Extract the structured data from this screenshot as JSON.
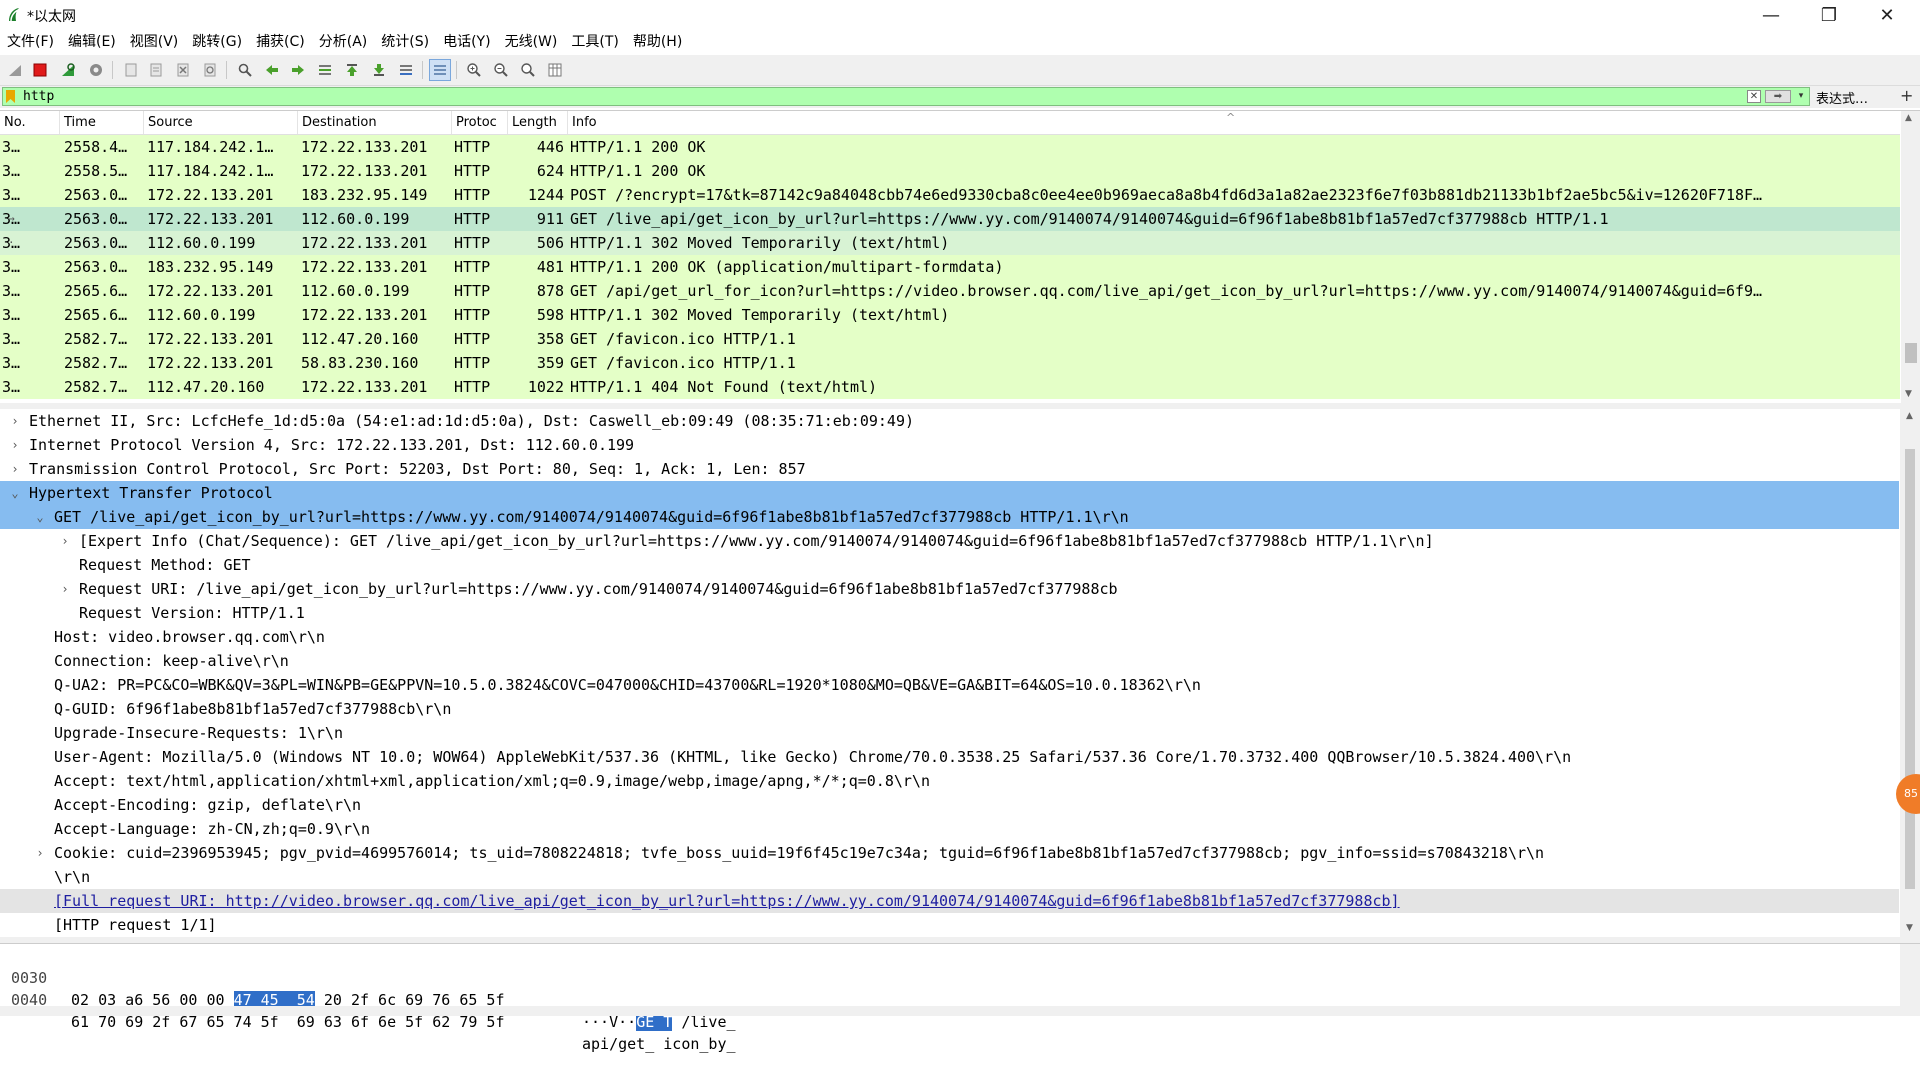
{
  "window": {
    "title": "*以太网",
    "min_glyph": "—",
    "max_glyph": "❐",
    "close_glyph": "✕"
  },
  "menu": [
    "文件(F)",
    "编辑(E)",
    "视图(V)",
    "跳转(G)",
    "捕获(C)",
    "分析(A)",
    "统计(S)",
    "电话(Y)",
    "无线(W)",
    "工具(T)",
    "帮助(H)"
  ],
  "toolbar_icons": [
    "shark-fin-icon",
    "stop-capture-icon",
    "restart-capture-icon",
    "capture-options-icon",
    "open-file-icon",
    "save-file-icon",
    "close-file-icon",
    "reload-icon",
    "find-packet-icon",
    "go-back-icon",
    "go-forward-icon",
    "go-to-packet-icon",
    "go-first-icon",
    "go-last-icon",
    "auto-scroll-icon",
    "colorize-icon",
    "zoom-in-icon",
    "zoom-out-icon",
    "zoom-reset-icon",
    "resize-columns-icon"
  ],
  "filter": {
    "value": "http",
    "expression_button": "表达式…",
    "plus": "+",
    "clear_glyph": "✕",
    "apply_glyph": "➡",
    "dropdown_glyph": "▾",
    "bg_color": "#afffaf"
  },
  "packet_list": {
    "columns": [
      "No.",
      "Time",
      "Source",
      "Destination",
      "Protoc",
      "Length",
      "Info"
    ],
    "sort_caret": "^",
    "rows": [
      {
        "no": "3…",
        "time": "2558.4…",
        "source": "117.184.242.1…",
        "destination": "172.22.133.201",
        "protocol": "HTTP",
        "length": "446",
        "info": "HTTP/1.1 200 OK"
      },
      {
        "no": "3…",
        "time": "2558.5…",
        "source": "117.184.242.1…",
        "destination": "172.22.133.201",
        "protocol": "HTTP",
        "length": "624",
        "info": "HTTP/1.1 200 OK"
      },
      {
        "no": "3…",
        "time": "2563.0…",
        "source": "172.22.133.201",
        "destination": "183.232.95.149",
        "protocol": "HTTP",
        "length": "1244",
        "info": "POST /?encrypt=17&tk=87142c9a84048cbb74e6ed9330cba8c0ee4ee0b969aeca8a8b4fd6d3a1a82ae2323f6e7f03b881db21133b1bf2ae5bc5&iv=12620F718F…"
      },
      {
        "no": "3…",
        "time": "2563.0…",
        "source": "172.22.133.201",
        "destination": "112.60.0.199",
        "protocol": "HTTP",
        "length": "911",
        "info": "GET /live_api/get_icon_by_url?url=https://www.yy.com/9140074/9140074&guid=6f96f1abe8b81bf1a57ed7cf377988cb HTTP/1.1",
        "selected": true
      },
      {
        "no": "3…",
        "time": "2563.0…",
        "source": "112.60.0.199",
        "destination": "172.22.133.201",
        "protocol": "HTTP",
        "length": "506",
        "info": "HTTP/1.1 302 Moved Temporarily  (text/html)",
        "related": true
      },
      {
        "no": "3…",
        "time": "2563.0…",
        "source": "183.232.95.149",
        "destination": "172.22.133.201",
        "protocol": "HTTP",
        "length": "481",
        "info": "HTTP/1.1 200 OK  (application/multipart-formdata)"
      },
      {
        "no": "3…",
        "time": "2565.6…",
        "source": "172.22.133.201",
        "destination": "112.60.0.199",
        "protocol": "HTTP",
        "length": "878",
        "info": "GET /api/get_url_for_icon?url=https://video.browser.qq.com/live_api/get_icon_by_url?url=https://www.yy.com/9140074/9140074&guid=6f9…"
      },
      {
        "no": "3…",
        "time": "2565.6…",
        "source": "112.60.0.199",
        "destination": "172.22.133.201",
        "protocol": "HTTP",
        "length": "598",
        "info": "HTTP/1.1 302 Moved Temporarily  (text/html)"
      },
      {
        "no": "3…",
        "time": "2582.7…",
        "source": "172.22.133.201",
        "destination": "112.47.20.160",
        "protocol": "HTTP",
        "length": "358",
        "info": "GET /favicon.ico HTTP/1.1"
      },
      {
        "no": "3…",
        "time": "2582.7…",
        "source": "172.22.133.201",
        "destination": "58.83.230.160",
        "protocol": "HTTP",
        "length": "359",
        "info": "GET /favicon.ico HTTP/1.1"
      },
      {
        "no": "3…",
        "time": "2582.7…",
        "source": "112.47.20.160",
        "destination": "172.22.133.201",
        "protocol": "HTTP",
        "length": "1022",
        "info": "HTTP/1.1 404 Not Found  (text/html)"
      }
    ],
    "row_bg": "#e4ffc7",
    "selected_bg": "#bfe7cf"
  },
  "details": {
    "rows": [
      {
        "indent": 0,
        "expander": "›",
        "text": "Ethernet II, Src: LcfcHefe_1d:d5:0a (54:e1:ad:1d:d5:0a), Dst: Caswell_eb:09:49 (08:35:71:eb:09:49)"
      },
      {
        "indent": 0,
        "expander": "›",
        "text": "Internet Protocol Version 4, Src: 172.22.133.201, Dst: 112.60.0.199"
      },
      {
        "indent": 0,
        "expander": "›",
        "text": "Transmission Control Protocol, Src Port: 52203, Dst Port: 80, Seq: 1, Ack: 1, Len: 857"
      },
      {
        "indent": 0,
        "expander": "⌄",
        "text": "Hypertext Transfer Protocol",
        "highlight": true
      },
      {
        "indent": 1,
        "expander": "⌄",
        "text": "GET /live_api/get_icon_by_url?url=https://www.yy.com/9140074/9140074&guid=6f96f1abe8b81bf1a57ed7cf377988cb HTTP/1.1\\r\\n",
        "highlight": true
      },
      {
        "indent": 2,
        "expander": "›",
        "text": "[Expert Info (Chat/Sequence): GET /live_api/get_icon_by_url?url=https://www.yy.com/9140074/9140074&guid=6f96f1abe8b81bf1a57ed7cf377988cb HTTP/1.1\\r\\n]"
      },
      {
        "indent": 2,
        "expander": "",
        "text": "Request Method: GET"
      },
      {
        "indent": 2,
        "expander": "›",
        "text": "Request URI: /live_api/get_icon_by_url?url=https://www.yy.com/9140074/9140074&guid=6f96f1abe8b81bf1a57ed7cf377988cb"
      },
      {
        "indent": 2,
        "expander": "",
        "text": "Request Version: HTTP/1.1"
      },
      {
        "indent": 1,
        "expander": "",
        "text": "Host: video.browser.qq.com\\r\\n"
      },
      {
        "indent": 1,
        "expander": "",
        "text": "Connection: keep-alive\\r\\n"
      },
      {
        "indent": 1,
        "expander": "",
        "text": "Q-UA2: PR=PC&CO=WBK&QV=3&PL=WIN&PB=GE&PPVN=10.5.0.3824&COVC=047000&CHID=43700&RL=1920*1080&MO=QB&VE=GA&BIT=64&OS=10.0.18362\\r\\n"
      },
      {
        "indent": 1,
        "expander": "",
        "text": "Q-GUID: 6f96f1abe8b81bf1a57ed7cf377988cb\\r\\n"
      },
      {
        "indent": 1,
        "expander": "",
        "text": "Upgrade-Insecure-Requests: 1\\r\\n"
      },
      {
        "indent": 1,
        "expander": "",
        "text": "User-Agent: Mozilla/5.0 (Windows NT 10.0; WOW64) AppleWebKit/537.36 (KHTML, like Gecko) Chrome/70.0.3538.25 Safari/537.36 Core/1.70.3732.400 QQBrowser/10.5.3824.400\\r\\n"
      },
      {
        "indent": 1,
        "expander": "",
        "text": "Accept: text/html,application/xhtml+xml,application/xml;q=0.9,image/webp,image/apng,*/*;q=0.8\\r\\n"
      },
      {
        "indent": 1,
        "expander": "",
        "text": "Accept-Encoding: gzip, deflate\\r\\n"
      },
      {
        "indent": 1,
        "expander": "",
        "text": "Accept-Language: zh-CN,zh;q=0.9\\r\\n"
      },
      {
        "indent": 1,
        "expander": "›",
        "text": "Cookie: cuid=2396953945; pgv_pvid=4699576014; ts_uid=7808224818; tvfe_boss_uuid=19f6f45c19e7c34a; tguid=6f96f1abe8b81bf1a57ed7cf377988cb; pgv_info=ssid=s70843218\\r\\n"
      },
      {
        "indent": 1,
        "expander": "",
        "text": "\\r\\n"
      },
      {
        "indent": 1,
        "expander": "",
        "text": "[Full request URI: http://video.browser.qq.com/live_api/get_icon_by_url?url=https://www.yy.com/9140074/9140074&guid=6f96f1abe8b81bf1a57ed7cf377988cb]",
        "link": true
      },
      {
        "indent": 1,
        "expander": "",
        "text": "[HTTP request 1/1]"
      }
    ],
    "highlight_bg": "#86bcf0",
    "floating_badge": "85"
  },
  "bytes": {
    "rows": [
      {
        "offset": "0030",
        "hex_pre": "02 03 a6 56 00 00 ",
        "hex_sel": "47 45  54",
        "hex_post": " 20 2f 6c 69 76 65 5f",
        "ascii_pre": "···V··",
        "ascii_sel": "GE T",
        "ascii_post": " /live_"
      },
      {
        "offset": "0040",
        "hex_pre": "61 70 69 2f 67 65 74 5f  69 63 6f 6e 5f 62 79 5f",
        "hex_sel": "",
        "hex_post": "",
        "ascii_pre": "api/get_ icon_by_",
        "ascii_sel": "",
        "ascii_post": ""
      }
    ]
  }
}
